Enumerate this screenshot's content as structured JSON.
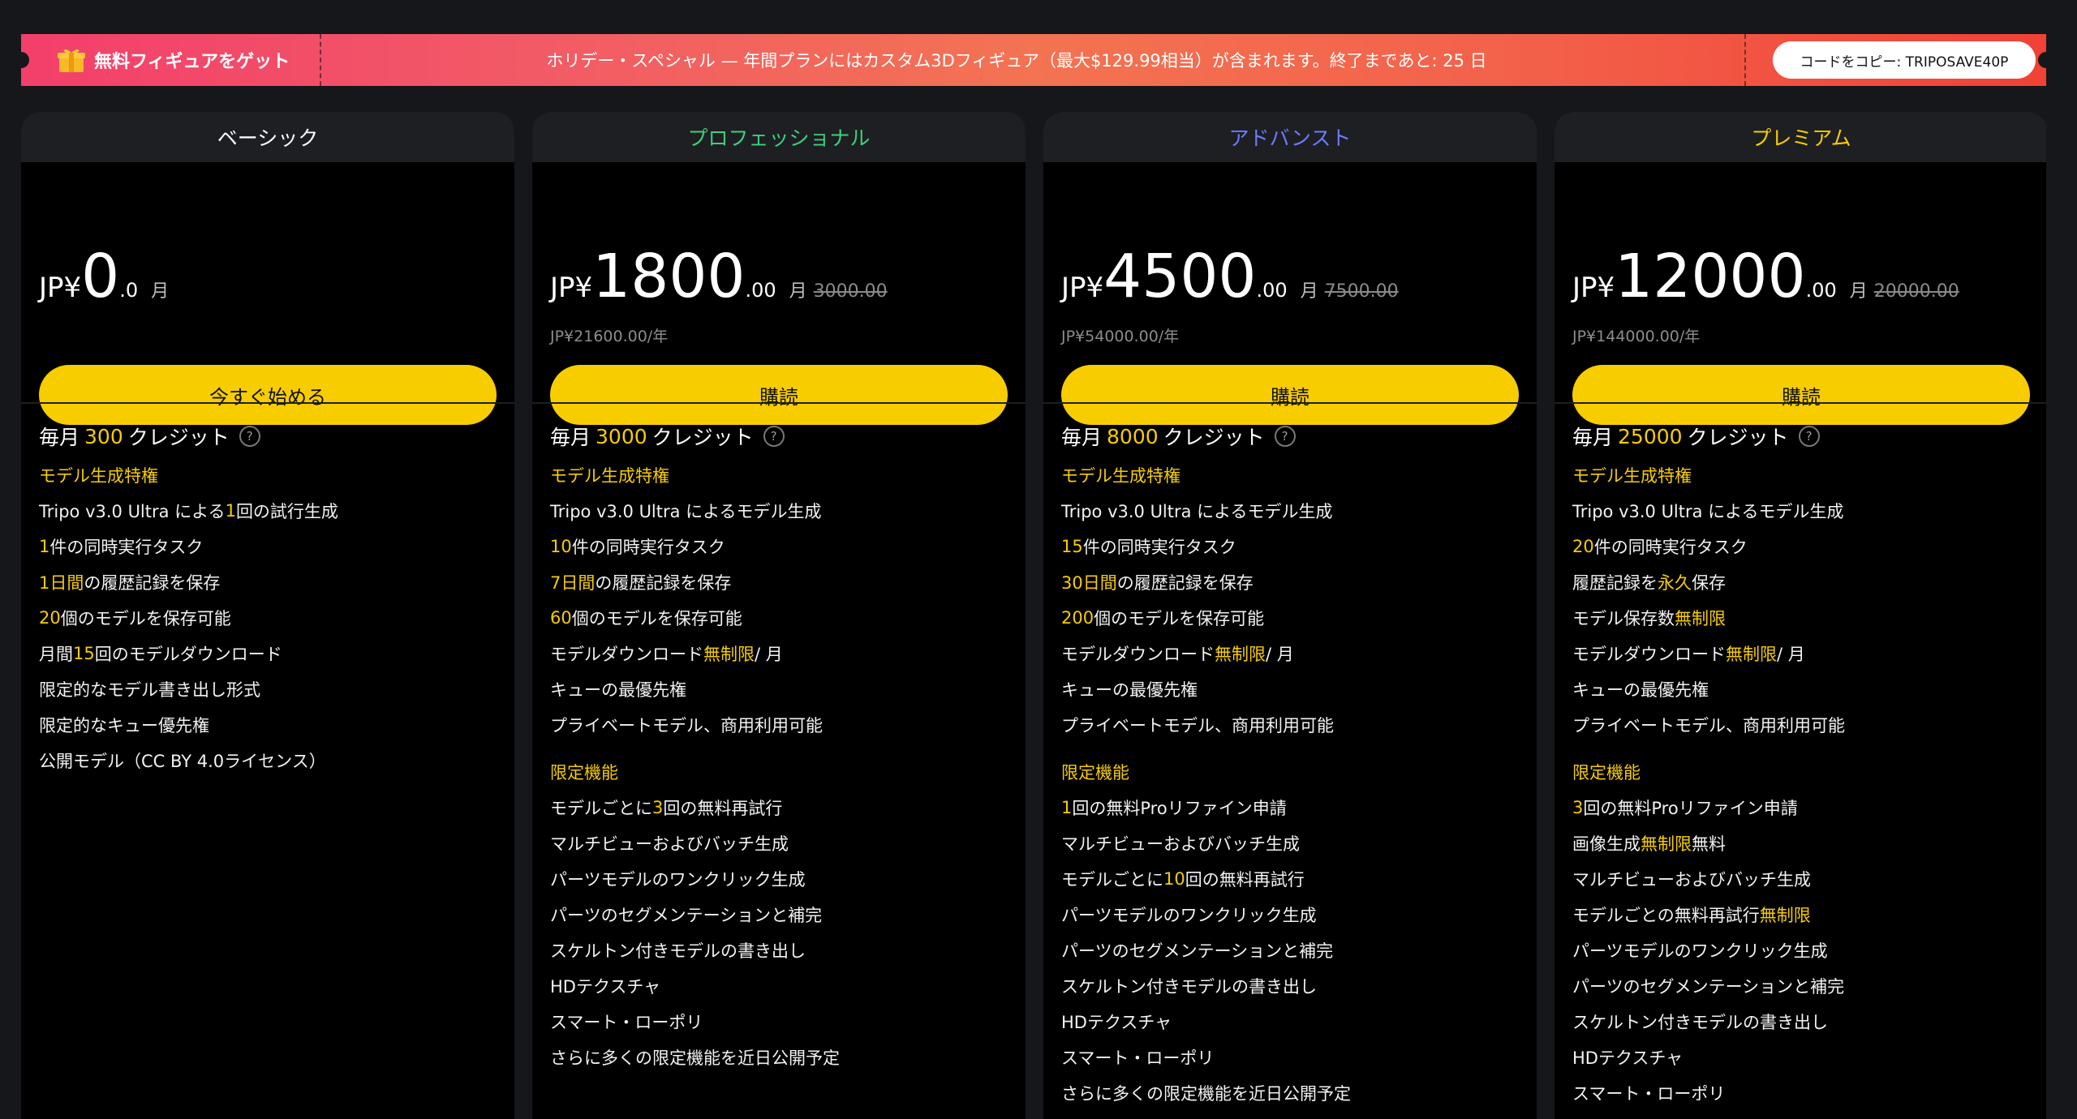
{
  "banner": {
    "left_label": "無料フィギュアをゲット",
    "center_text": "ホリデー・スペシャル — 年間プランにはカスタム3Dフィギュア（最大$129.99相当）が含まれます。終了まであと: 25 日",
    "copy_button": "コードをコピー: TRIPOSAVE40P"
  },
  "colors": {
    "accent_yellow": "#f7cd00",
    "pro_green": "#3ed07a",
    "advanced_blue": "#6b7cff"
  },
  "plans": [
    {
      "name": "ベーシック",
      "currency": "JP¥",
      "amount": "0",
      "decimal": ".0",
      "per": "月",
      "original": "",
      "yearly": "",
      "cta": "今すぐ始める",
      "credits_prefix": "毎月",
      "credits_num": "300",
      "credits_suffix": "クレジット",
      "sections": [
        {
          "title": "モデル生成特権",
          "items": [
            [
              {
                "t": "Tripo v3.0 Ultra による "
              },
              {
                "t": "1",
                "h": 1
              },
              {
                "t": " 回の試行生成"
              }
            ],
            [
              {
                "t": "1",
                "h": 1
              },
              {
                "t": " 件の同時実行タスク"
              }
            ],
            [
              {
                "t": "1日間",
                "h": 1
              },
              {
                "t": " の履歴記録を保存"
              }
            ],
            [
              {
                "t": "20",
                "h": 1
              },
              {
                "t": " 個のモデルを保存可能"
              }
            ],
            [
              {
                "t": "月間 "
              },
              {
                "t": "15",
                "h": 1
              },
              {
                "t": " 回のモデルダウンロード"
              }
            ],
            [
              {
                "t": "限定的なモデル書き出し形式"
              }
            ],
            [
              {
                "t": "限定的なキュー優先権"
              }
            ],
            [
              {
                "t": "公開モデル（CC BY 4.0ライセンス）"
              }
            ]
          ]
        }
      ]
    },
    {
      "name": "プロフェッショナル",
      "currency": "JP¥",
      "amount": "1800",
      "decimal": ".00",
      "per": "月",
      "original": "3000.00",
      "yearly": "JP¥21600.00/年",
      "cta": "購読",
      "credits_prefix": "毎月",
      "credits_num": "3000",
      "credits_suffix": "クレジット",
      "sections": [
        {
          "title": "モデル生成特権",
          "items": [
            [
              {
                "t": "Tripo v3.0 Ultra によるモデル生成"
              }
            ],
            [
              {
                "t": "10",
                "h": 1
              },
              {
                "t": " 件の同時実行タスク"
              }
            ],
            [
              {
                "t": "7日間",
                "h": 1
              },
              {
                "t": " の履歴記録を保存"
              }
            ],
            [
              {
                "t": "60",
                "h": 1
              },
              {
                "t": " 個のモデルを保存可能"
              }
            ],
            [
              {
                "t": "モデルダウンロード "
              },
              {
                "t": "無制限",
                "h": 1
              },
              {
                "t": " / 月"
              }
            ],
            [
              {
                "t": "キューの最優先権"
              }
            ],
            [
              {
                "t": "プライベートモデル、商用利用可能"
              }
            ]
          ]
        },
        {
          "title": "限定機能",
          "items": [
            [
              {
                "t": "モデルごとに "
              },
              {
                "t": "3",
                "h": 1
              },
              {
                "t": " 回の無料再試行"
              }
            ],
            [
              {
                "t": "マルチビューおよびバッチ生成"
              }
            ],
            [
              {
                "t": "パーツモデルのワンクリック生成"
              }
            ],
            [
              {
                "t": "パーツのセグメンテーションと補完"
              }
            ],
            [
              {
                "t": "スケルトン付きモデルの書き出し"
              }
            ],
            [
              {
                "t": "HDテクスチャ"
              }
            ],
            [
              {
                "t": "スマート・ローポリ"
              }
            ],
            [
              {
                "t": "さらに多くの限定機能を近日公開予定"
              }
            ]
          ]
        }
      ]
    },
    {
      "name": "アドバンスト",
      "currency": "JP¥",
      "amount": "4500",
      "decimal": ".00",
      "per": "月",
      "original": "7500.00",
      "yearly": "JP¥54000.00/年",
      "cta": "購読",
      "credits_prefix": "毎月",
      "credits_num": "8000",
      "credits_suffix": "クレジット",
      "sections": [
        {
          "title": "モデル生成特権",
          "items": [
            [
              {
                "t": "Tripo v3.0 Ultra によるモデル生成"
              }
            ],
            [
              {
                "t": "15",
                "h": 1
              },
              {
                "t": " 件の同時実行タスク"
              }
            ],
            [
              {
                "t": "30日間",
                "h": 1
              },
              {
                "t": " の履歴記録を保存"
              }
            ],
            [
              {
                "t": "200",
                "h": 1
              },
              {
                "t": " 個のモデルを保存可能"
              }
            ],
            [
              {
                "t": "モデルダウンロード "
              },
              {
                "t": "無制限",
                "h": 1
              },
              {
                "t": " / 月"
              }
            ],
            [
              {
                "t": "キューの最優先権"
              }
            ],
            [
              {
                "t": "プライベートモデル、商用利用可能"
              }
            ]
          ]
        },
        {
          "title": "限定機能",
          "items": [
            [
              {
                "t": "1",
                "h": 1
              },
              {
                "t": " 回の無料Proリファイン申請"
              }
            ],
            [
              {
                "t": "マルチビューおよびバッチ生成"
              }
            ],
            [
              {
                "t": "モデルごとに "
              },
              {
                "t": "10",
                "h": 1
              },
              {
                "t": " 回の無料再試行"
              }
            ],
            [
              {
                "t": "パーツモデルのワンクリック生成"
              }
            ],
            [
              {
                "t": "パーツのセグメンテーションと補完"
              }
            ],
            [
              {
                "t": "スケルトン付きモデルの書き出し"
              }
            ],
            [
              {
                "t": "HDテクスチャ"
              }
            ],
            [
              {
                "t": "スマート・ローポリ"
              }
            ],
            [
              {
                "t": "さらに多くの限定機能を近日公開予定"
              }
            ]
          ]
        }
      ]
    },
    {
      "name": "プレミアム",
      "currency": "JP¥",
      "amount": "12000",
      "decimal": ".00",
      "per": "月",
      "original": "20000.00",
      "yearly": "JP¥144000.00/年",
      "cta": "購読",
      "credits_prefix": "毎月",
      "credits_num": "25000",
      "credits_suffix": "クレジット",
      "sections": [
        {
          "title": "モデル生成特権",
          "items": [
            [
              {
                "t": "Tripo v3.0 Ultra によるモデル生成"
              }
            ],
            [
              {
                "t": "20",
                "h": 1
              },
              {
                "t": " 件の同時実行タスク"
              }
            ],
            [
              {
                "t": "履歴記録を "
              },
              {
                "t": "永久",
                "h": 1
              },
              {
                "t": " 保存"
              }
            ],
            [
              {
                "t": "モデル保存数 "
              },
              {
                "t": "無制限",
                "h": 1
              }
            ],
            [
              {
                "t": "モデルダウンロード "
              },
              {
                "t": "無制限",
                "h": 1
              },
              {
                "t": " / 月"
              }
            ],
            [
              {
                "t": "キューの最優先権"
              }
            ],
            [
              {
                "t": "プライベートモデル、商用利用可能"
              }
            ]
          ]
        },
        {
          "title": "限定機能",
          "items": [
            [
              {
                "t": "3",
                "h": 1
              },
              {
                "t": " 回の無料Proリファイン申請"
              }
            ],
            [
              {
                "t": "画像生成 "
              },
              {
                "t": "無制限",
                "h": 1
              },
              {
                "t": " 無料"
              }
            ],
            [
              {
                "t": "マルチビューおよびバッチ生成"
              }
            ],
            [
              {
                "t": "モデルごとの無料再試行 "
              },
              {
                "t": "無制限",
                "h": 1
              }
            ],
            [
              {
                "t": "パーツモデルのワンクリック生成"
              }
            ],
            [
              {
                "t": "パーツのセグメンテーションと補完"
              }
            ],
            [
              {
                "t": "スケルトン付きモデルの書き出し"
              }
            ],
            [
              {
                "t": "HDテクスチャ"
              }
            ],
            [
              {
                "t": "スマート・ローポリ"
              }
            ]
          ]
        }
      ]
    }
  ]
}
